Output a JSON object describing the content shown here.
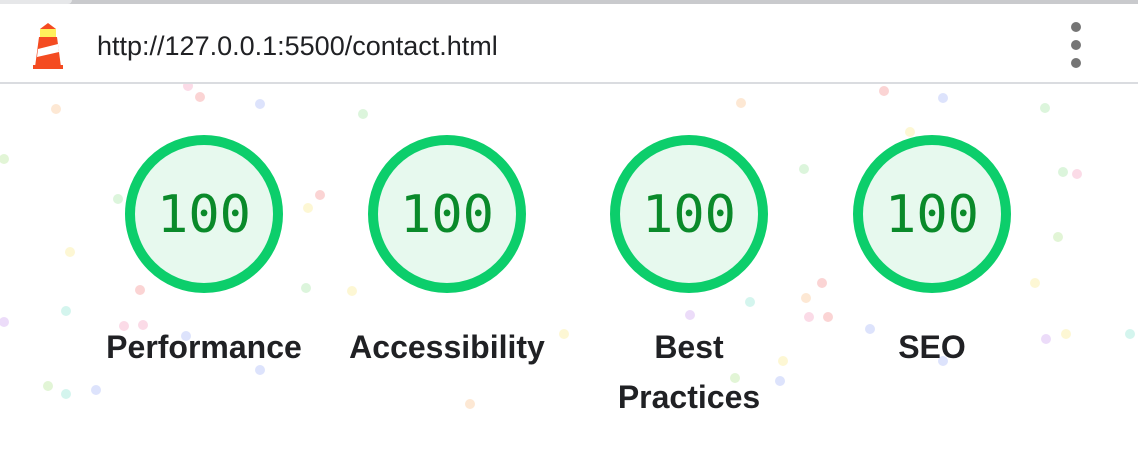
{
  "report": {
    "url": "http://127.0.0.1:5500/contact.html",
    "logo_icon": "lighthouse-icon",
    "menu_icon": "more-vertical-icon"
  },
  "categories": [
    {
      "score": "100",
      "label": "Performance"
    },
    {
      "score": "100",
      "label": "Accessibility"
    },
    {
      "score": "100",
      "label": "Best Practices"
    },
    {
      "score": "100",
      "label": "SEO"
    }
  ],
  "colors": {
    "pass": "#0cce6b",
    "pass_fill": "#e7f9ee",
    "score_text": "#0a8a2a"
  }
}
